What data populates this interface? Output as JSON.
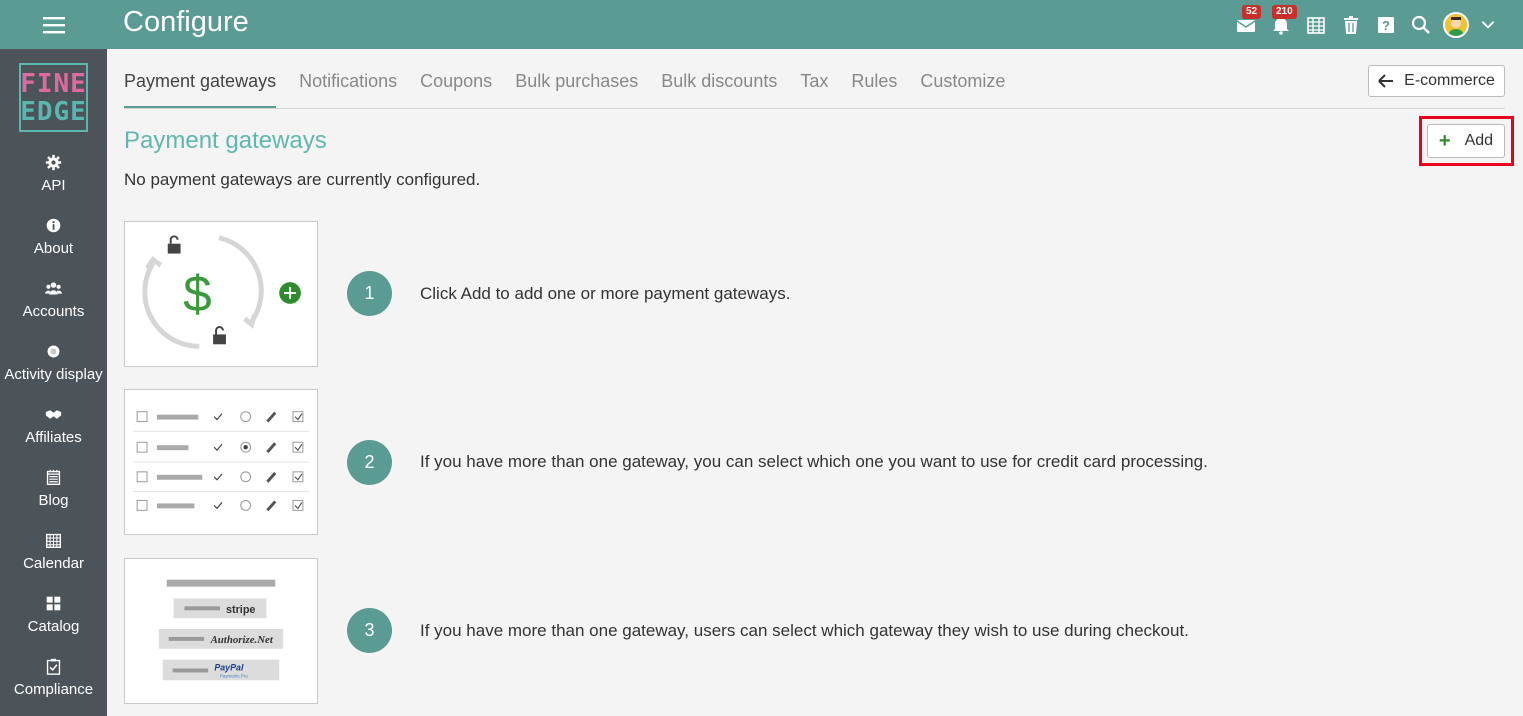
{
  "header": {
    "title": "Configure",
    "mail_badge": "52",
    "notif_badge": "210"
  },
  "sidebar": {
    "logo_line1": "FINE",
    "logo_line2": "EDGE",
    "items": [
      {
        "label": "API",
        "icon": "gear-icon"
      },
      {
        "label": "About",
        "icon": "info-icon"
      },
      {
        "label": "Accounts",
        "icon": "users-icon"
      },
      {
        "label": "Activity display",
        "icon": "dot-icon"
      },
      {
        "label": "Affiliates",
        "icon": "handshake-icon"
      },
      {
        "label": "Blog",
        "icon": "blog-icon"
      },
      {
        "label": "Calendar",
        "icon": "calendar-icon"
      },
      {
        "label": "Catalog",
        "icon": "grid-icon"
      },
      {
        "label": "Compliance",
        "icon": "checklist-icon"
      }
    ]
  },
  "tabs": [
    {
      "label": "Payment gateways",
      "active": true
    },
    {
      "label": "Notifications",
      "active": false
    },
    {
      "label": "Coupons",
      "active": false
    },
    {
      "label": "Bulk purchases",
      "active": false
    },
    {
      "label": "Bulk discounts",
      "active": false
    },
    {
      "label": "Tax",
      "active": false
    },
    {
      "label": "Rules",
      "active": false
    },
    {
      "label": "Customize",
      "active": false
    }
  ],
  "back_button": "E-commerce",
  "main": {
    "title": "Payment gateways",
    "empty_message": "No payment gateways are currently configured.",
    "add_label": "Add",
    "steps": [
      {
        "number": "1",
        "text": "Click Add to add one or more payment gateways."
      },
      {
        "number": "2",
        "text": "If you have more than one gateway, you can select which one you want to use for credit card processing."
      },
      {
        "number": "3",
        "text": "If you have more than one gateway, users can select which gateway they wish to use during checkout."
      }
    ],
    "illustration": {
      "currency_symbol": "$",
      "gateways": [
        "stripe",
        "Authorize.Net",
        "PayPal"
      ],
      "paypal_sub": "Payments Pro"
    }
  },
  "colors": {
    "topbar": "#5a9b93",
    "sidebar": "#4d5459",
    "accent": "#5fb7ae",
    "highlight": "#e8001c",
    "badge": "#c9302c"
  }
}
